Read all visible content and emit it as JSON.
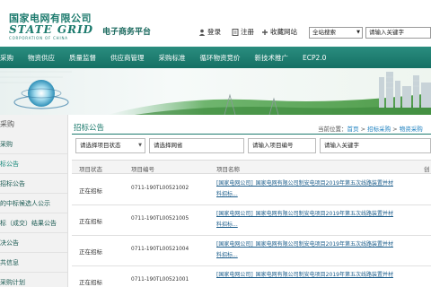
{
  "header": {
    "company_cn": "国家电网有限公司",
    "company_en": "STATE GRID",
    "company_corp": "CORPORATION OF CHINA",
    "platform_title": "电子商务平台",
    "links": {
      "login": "登录",
      "register": "注册",
      "favorite": "收藏网站"
    },
    "search_scope": "全站搜索",
    "search_value": "请输入关键字"
  },
  "nav": {
    "items": [
      "采购",
      "物资供应",
      "质量监督",
      "供应商管理",
      "采购标准",
      "循环物资竞价",
      "新技术推广",
      "ECP2.0"
    ]
  },
  "sidebar": {
    "title": "采购",
    "items": [
      "采购",
      "标公告",
      "招标公告",
      "的中标候选人公示",
      "标（成交）结果公告",
      "决公告",
      "共信息",
      "采购计划"
    ]
  },
  "main": {
    "title": "招标公告",
    "breadcrumb": {
      "prefix": "当前位置：",
      "home": "首页",
      "sep1": " > ",
      "cat": "招标采购",
      "sep2": " > ",
      "last": "物资采购"
    },
    "filters": {
      "project_status": "请选择项目状态",
      "province": "请选择网省",
      "project_no": "请输入项目编号",
      "keyword": "请输入关键字"
    },
    "columns": {
      "status": "项目状态",
      "number": "项目编号",
      "name": "项目名称",
      "extra": "创"
    },
    "rows": [
      {
        "status": "正在招标",
        "number": "0711-190TL00521002",
        "name1": "[国家电网公司]_国家电网有限公司制安电项目2019年第五次线路装置并材",
        "name2": "料招标..."
      },
      {
        "status": "正在招标",
        "number": "0711-190TL00521005",
        "name1": "[国家电网公司]_国家电网有限公司制安电项目2019年第五次线路装置并材",
        "name2": "料招标..."
      },
      {
        "status": "正在招标",
        "number": "0711-190TL00521004",
        "name1": "[国家电网公司]_国家电网有限公司制安电项目2019年第五次线路装置并材",
        "name2": "料招标..."
      },
      {
        "status": "正在招标",
        "number": "0711-190TL00521001",
        "name1": "[国家电网公司]_国家电网有限公司制安电项目2019年第五次线路装置并材",
        "name2": ""
      }
    ]
  },
  "colors": {
    "brand": "#1c7a6d",
    "nav": "#1e8073",
    "link": "#1a5c8a"
  }
}
